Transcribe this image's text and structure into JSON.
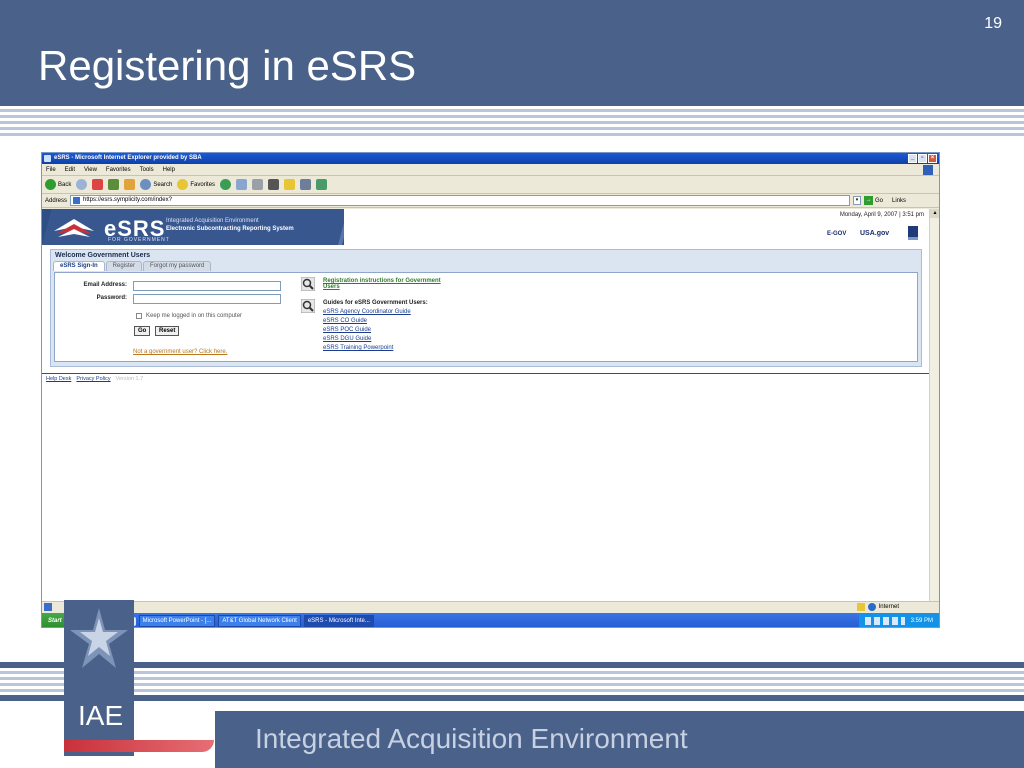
{
  "slide": {
    "title": "Registering in eSRS",
    "number": "19",
    "footer_text": "Integrated Acquisition Environment",
    "logo_text": "IAE"
  },
  "browser": {
    "window_title": "eSRS - Microsoft Internet Explorer provided by SBA",
    "menu": [
      "File",
      "Edit",
      "View",
      "Favorites",
      "Tools",
      "Help"
    ],
    "toolbar": {
      "back": "Back",
      "search": "Search",
      "favorites": "Favorites"
    },
    "address_label": "Address",
    "address_url": "https://esrs.symplicity.com/index?",
    "go_label": "Go",
    "links_label": "Links",
    "status_zone": "Internet"
  },
  "page": {
    "logo": "eSRS",
    "logo_sub": "FOR GOVERNMENT",
    "iae_line1": "Integrated Acquisition Environment",
    "iae_line2": "Electronic Subcontracting Reporting System",
    "date": "Monday, April 9, 2007 | 3:51 pm",
    "egov": "E-GOV",
    "usagov": "USA.gov",
    "panel_title": "Welcome Government Users",
    "tabs": [
      "eSRS Sign-In",
      "Register",
      "Forgot my password"
    ],
    "form": {
      "email_label": "Email Address:",
      "password_label": "Password:",
      "keep_logged_in": "Keep me logged in on this computer",
      "go_button": "Go",
      "reset_button": "Reset",
      "not_gov_link": "Not a government user? Click here."
    },
    "registration_link": "Registration instructions for Government Users",
    "guides_heading": "Guides for eSRS Government Users:",
    "guides": [
      "eSRS Agency Coordinator Guide",
      "eSRS CO Guide",
      "eSRS POC Guide",
      "eSRS DGU Guide",
      "eSRS Training Powerpoint"
    ],
    "footer": {
      "help_desk": "Help Desk",
      "privacy_policy": "Privacy Policy",
      "version": "Version 1.7"
    }
  },
  "taskbar": {
    "start": "Start",
    "tasks": [
      "Microsoft PowerPoint - [...",
      "AT&T Global Network Client",
      "eSRS - Microsoft Inte..."
    ],
    "clock": "3:59 PM"
  },
  "colors": {
    "slide_blue": "#4a6289",
    "esrs_navy": "#2e4f86",
    "link_blue": "#1a3d8f"
  }
}
